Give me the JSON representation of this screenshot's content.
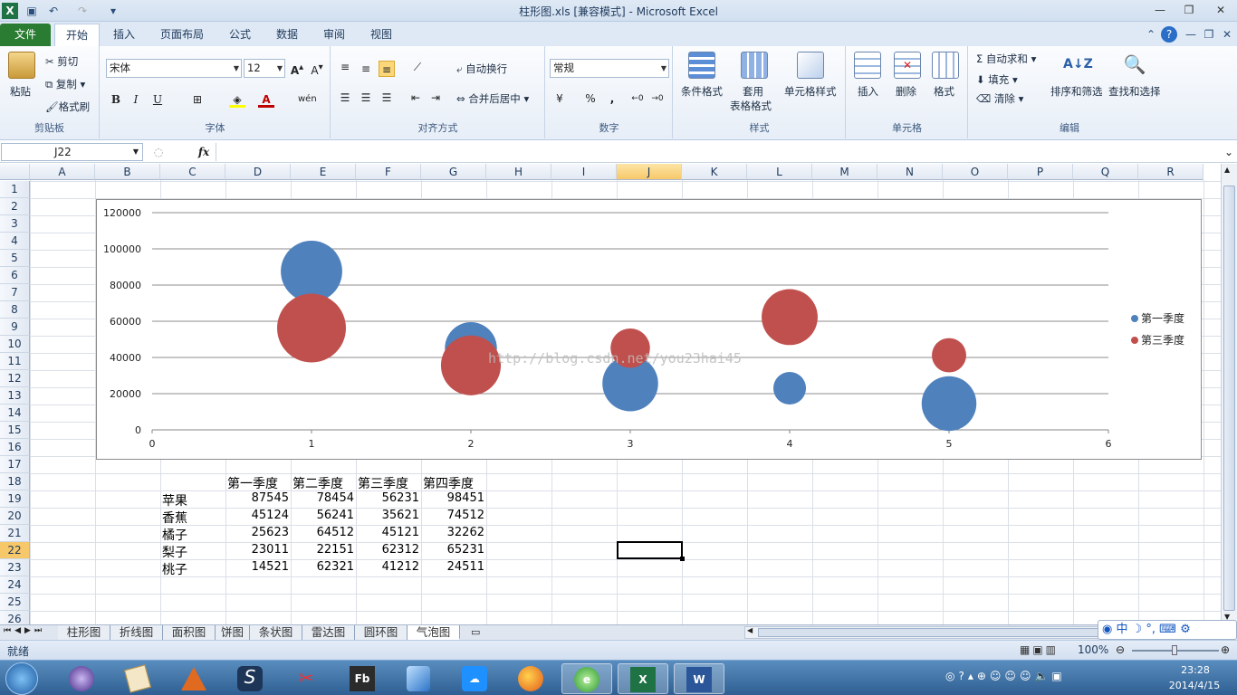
{
  "window": {
    "title": "柱形图.xls  [兼容模式]  -  Microsoft Excel"
  },
  "ribbon_tabs": [
    "文件",
    "开始",
    "插入",
    "页面布局",
    "公式",
    "数据",
    "审阅",
    "视图"
  ],
  "ribbon": {
    "clipboard": {
      "paste": "粘贴",
      "cut": "剪切",
      "copy": "复制",
      "format_painter": "格式刷",
      "label": "剪贴板"
    },
    "font": {
      "name": "宋体",
      "size": "12",
      "bold": "B",
      "italic": "I",
      "underline": "U",
      "label": "字体"
    },
    "alignment": {
      "wrap": "自动换行",
      "merge": "合并后居中",
      "label": "对齐方式"
    },
    "number": {
      "format": "常规",
      "percent": "%",
      "comma": ",",
      "label": "数字"
    },
    "styles": {
      "conditional": "条件格式",
      "table_line1": "套用",
      "table_line2": "表格格式",
      "cell_styles": "单元格样式",
      "label": "样式"
    },
    "cells": {
      "insert": "插入",
      "delete": "删除",
      "format": "格式",
      "label": "单元格"
    },
    "editing": {
      "autosum": "自动求和",
      "fill": "填充",
      "clear": "清除",
      "sort": "排序和筛选",
      "find": "查找和选择",
      "label": "编辑"
    }
  },
  "formula_bar": {
    "name_box": "J22",
    "fx": "fx",
    "content": ""
  },
  "columns": [
    "A",
    "B",
    "C",
    "D",
    "E",
    "F",
    "G",
    "H",
    "I",
    "J",
    "K",
    "L",
    "M",
    "N",
    "O",
    "P",
    "Q",
    "R"
  ],
  "selected_column": "J",
  "selected_row": "22",
  "rows": [
    "1",
    "2",
    "3",
    "4",
    "5",
    "6",
    "7",
    "8",
    "9",
    "10",
    "11",
    "12",
    "13",
    "14",
    "15",
    "16",
    "17",
    "18",
    "19",
    "20",
    "21",
    "22",
    "23",
    "24",
    "25",
    "26"
  ],
  "table": {
    "headers": [
      "第一季度",
      "第二季度",
      "第三季度",
      "第四季度"
    ],
    "rows": [
      {
        "name": "苹果",
        "v": [
          "87545",
          "78454",
          "56231",
          "98451"
        ]
      },
      {
        "name": "香蕉",
        "v": [
          "45124",
          "56241",
          "35621",
          "74512"
        ]
      },
      {
        "name": "橘子",
        "v": [
          "25623",
          "64512",
          "45121",
          "32262"
        ]
      },
      {
        "name": "梨子",
        "v": [
          "23011",
          "22151",
          "62312",
          "65231"
        ]
      },
      {
        "name": "桃子",
        "v": [
          "14521",
          "62321",
          "41212",
          "24511"
        ]
      }
    ]
  },
  "chart_data": {
    "type": "scatter",
    "subtype": "bubble",
    "x_ticks": [
      "0",
      "1",
      "2",
      "3",
      "4",
      "5",
      "6"
    ],
    "y_ticks": [
      "0",
      "20000",
      "40000",
      "60000",
      "80000",
      "100000",
      "120000"
    ],
    "xlim": [
      0,
      6
    ],
    "ylim": [
      0,
      120000
    ],
    "grid": "horizontal",
    "legend": "right",
    "watermark": "http://blog.csdn.net/you23hai45",
    "series": [
      {
        "name": "第一季度",
        "color": "#4f81bd",
        "points": [
          [
            1,
            87545,
            78454
          ],
          [
            2,
            45124,
            56241
          ],
          [
            3,
            25623,
            64512
          ],
          [
            4,
            23011,
            22151
          ],
          [
            5,
            14521,
            62321
          ]
        ]
      },
      {
        "name": "第三季度",
        "color": "#c0504d",
        "points": [
          [
            1,
            56231,
            98451
          ],
          [
            2,
            35621,
            74512
          ],
          [
            3,
            45121,
            32262
          ],
          [
            4,
            62312,
            65231
          ],
          [
            5,
            41212,
            24511
          ]
        ]
      }
    ]
  },
  "sheet_tabs": [
    "柱形图",
    "折线图",
    "面积图",
    "饼图",
    "条状图",
    "雷达图",
    "圆环图",
    "气泡图"
  ],
  "active_sheet": "气泡图",
  "status": {
    "ready": "就绪",
    "zoom": "100%"
  },
  "taskbar": {
    "time": "23:28",
    "date": "2014/4/15",
    "ime": "中"
  }
}
